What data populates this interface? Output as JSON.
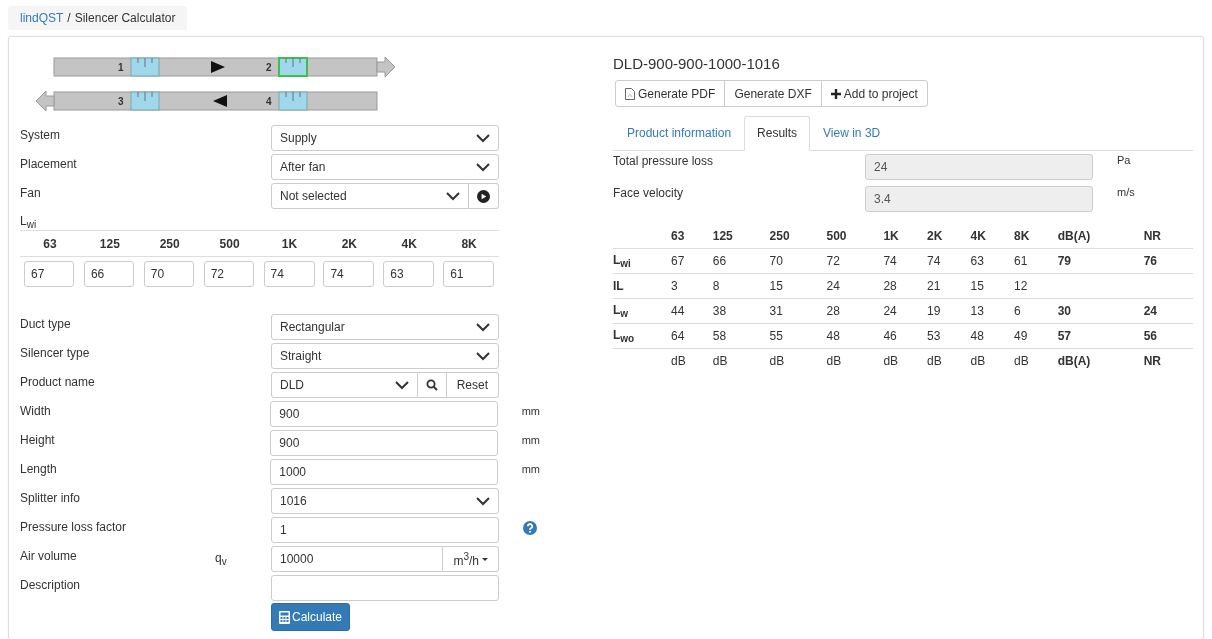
{
  "breadcrumb": {
    "link": "lindQST",
    "separator": "/",
    "current": "Silencer Calculator"
  },
  "diagram": {
    "ducts": [
      {
        "kind": "forward",
        "silencers": [
          {
            "label": "1",
            "selected": false
          },
          {
            "label": "2",
            "selected": true
          }
        ]
      },
      {
        "kind": "reverse",
        "silencers": [
          {
            "label": "3",
            "selected": false
          },
          {
            "label": "4",
            "selected": false
          }
        ]
      }
    ]
  },
  "top_fields": [
    {
      "kind": "select",
      "label": "System",
      "value": "Supply"
    },
    {
      "kind": "select",
      "label": "Placement",
      "value": "After fan"
    },
    {
      "kind": "select-play",
      "label": "Fan",
      "value": "Not selected"
    }
  ],
  "lwi": {
    "label": "L$_{wi}$",
    "bands": [
      "63",
      "125",
      "250",
      "500",
      "1K",
      "2K",
      "4K",
      "8K"
    ],
    "values": [
      "67",
      "66",
      "70",
      "72",
      "74",
      "74",
      "63",
      "61"
    ]
  },
  "fields": [
    {
      "kind": "select",
      "label": "Duct type",
      "value": "Rectangular"
    },
    {
      "kind": "select",
      "label": "Silencer type",
      "value": "Straight"
    },
    {
      "kind": "select-search",
      "label": "Product name",
      "value": "DLD",
      "button": "Reset"
    },
    {
      "kind": "input",
      "label": "Width",
      "value": "900",
      "unit": "mm"
    },
    {
      "kind": "input",
      "label": "Height",
      "value": "900",
      "unit": "mm"
    },
    {
      "kind": "input",
      "label": "Length",
      "value": "1000",
      "unit": "mm"
    },
    {
      "kind": "select",
      "label": "Splitter info",
      "value": "1016"
    },
    {
      "kind": "input-help",
      "label": "Pressure loss factor",
      "value": "1"
    },
    {
      "kind": "input-unit-menu",
      "label": "Air volume",
      "symbol": "q$_{v}$",
      "value": "10000",
      "unit": "m$^{3}$/h"
    },
    {
      "kind": "input",
      "label": "Description"
    }
  ],
  "calculate_button": "Calculate",
  "product_title": "DLD-900-900-1000-1016",
  "actions": [
    {
      "kind": "pdf",
      "label": "Generate PDF"
    },
    {
      "kind": "plain",
      "label": "Generate DXF"
    },
    {
      "kind": "plus",
      "label": "Add to project"
    }
  ],
  "tabs": [
    {
      "label": "Product information",
      "selected": false
    },
    {
      "label": "Results",
      "selected": true
    },
    {
      "label": "View in 3D",
      "selected": false
    }
  ],
  "results": [
    {
      "label": "Total pressure loss",
      "value": "24",
      "unit": "Pa"
    },
    {
      "label": "Face velocity",
      "value": "3.4",
      "unit": "m/s"
    }
  ],
  "table": {
    "columns": [
      "63",
      "125",
      "250",
      "500",
      "1K",
      "2K",
      "4K",
      "8K",
      "dB(A)",
      "NR"
    ],
    "rows": [
      {
        "label": "L$_{wi}$",
        "cells": [
          "67",
          "66",
          "70",
          "72",
          "74",
          "74",
          "63",
          "61",
          "79",
          "76"
        ]
      },
      {
        "label": "IL",
        "cells": [
          "3",
          "8",
          "15",
          "24",
          "28",
          "21",
          "15",
          "12",
          "",
          ""
        ]
      },
      {
        "label": "L$_{w}$",
        "cells": [
          "44",
          "38",
          "31",
          "28",
          "24",
          "19",
          "13",
          "6",
          "30",
          "24"
        ]
      },
      {
        "label": "L$_{wo}$",
        "cells": [
          "64",
          "58",
          "55",
          "48",
          "46",
          "53",
          "48",
          "49",
          "57",
          "56"
        ]
      }
    ],
    "units": [
      "dB",
      "dB",
      "dB",
      "dB",
      "dB",
      "dB",
      "dB",
      "dB",
      "dB(A)",
      "NR"
    ]
  }
}
